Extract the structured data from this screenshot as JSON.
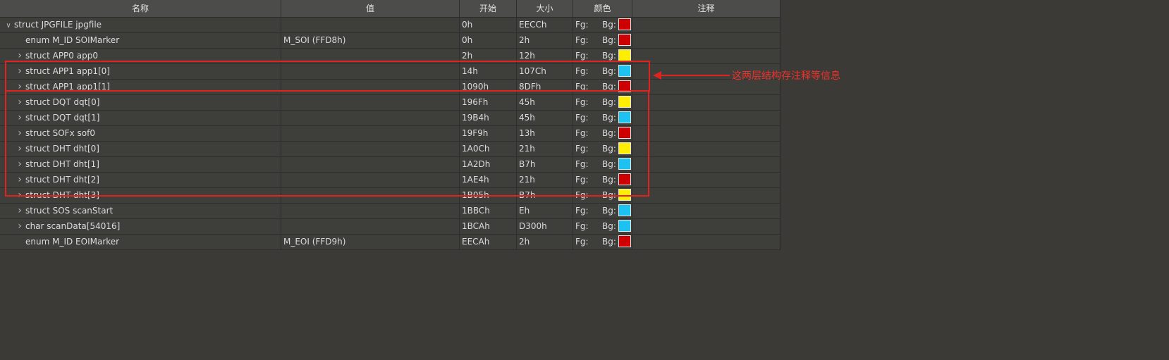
{
  "columns": {
    "name": "名称",
    "value": "值",
    "start": "开始",
    "size": "大小",
    "color": "颜色",
    "note": "注释"
  },
  "rows": [
    {
      "expand": "open",
      "level": 0,
      "name": "struct JPGFILE jpgfile",
      "value": "",
      "start": "0h",
      "size": "EECCh",
      "fg": "Fg:",
      "bg": "Bg:",
      "bgcolor": "#cc0000"
    },
    {
      "expand": "none",
      "level": 1,
      "name": "enum M_ID SOIMarker",
      "value": "M_SOI (FFD8h)",
      "start": "0h",
      "size": "2h",
      "fg": "Fg:",
      "bg": "Bg:",
      "bgcolor": "#cc0000"
    },
    {
      "expand": "closed",
      "level": 1,
      "name": "struct APP0 app0",
      "value": "",
      "start": "2h",
      "size": "12h",
      "fg": "Fg:",
      "bg": "Bg:",
      "bgcolor": "#ffee00"
    },
    {
      "expand": "closed",
      "level": 1,
      "name": "struct APP1 app1[0]",
      "value": "",
      "start": "14h",
      "size": "107Ch",
      "fg": "Fg:",
      "bg": "Bg:",
      "bgcolor": "#1ec2f0"
    },
    {
      "expand": "closed",
      "level": 1,
      "name": "struct APP1 app1[1]",
      "value": "",
      "start": "1090h",
      "size": "8DFh",
      "fg": "Fg:",
      "bg": "Bg:",
      "bgcolor": "#cc0000"
    },
    {
      "expand": "closed",
      "level": 1,
      "name": "struct DQT dqt[0]",
      "value": "",
      "start": "196Fh",
      "size": "45h",
      "fg": "Fg:",
      "bg": "Bg:",
      "bgcolor": "#ffee00"
    },
    {
      "expand": "closed",
      "level": 1,
      "name": "struct DQT dqt[1]",
      "value": "",
      "start": "19B4h",
      "size": "45h",
      "fg": "Fg:",
      "bg": "Bg:",
      "bgcolor": "#1ec2f0"
    },
    {
      "expand": "closed",
      "level": 1,
      "name": "struct SOFx sof0",
      "value": "",
      "start": "19F9h",
      "size": "13h",
      "fg": "Fg:",
      "bg": "Bg:",
      "bgcolor": "#cc0000"
    },
    {
      "expand": "closed",
      "level": 1,
      "name": "struct DHT dht[0]",
      "value": "",
      "start": "1A0Ch",
      "size": "21h",
      "fg": "Fg:",
      "bg": "Bg:",
      "bgcolor": "#ffee00"
    },
    {
      "expand": "closed",
      "level": 1,
      "name": "struct DHT dht[1]",
      "value": "",
      "start": "1A2Dh",
      "size": "B7h",
      "fg": "Fg:",
      "bg": "Bg:",
      "bgcolor": "#1ec2f0"
    },
    {
      "expand": "closed",
      "level": 1,
      "name": "struct DHT dht[2]",
      "value": "",
      "start": "1AE4h",
      "size": "21h",
      "fg": "Fg:",
      "bg": "Bg:",
      "bgcolor": "#cc0000"
    },
    {
      "expand": "closed",
      "level": 1,
      "name": "struct DHT dht[3]",
      "value": "",
      "start": "1B05h",
      "size": "B7h",
      "fg": "Fg:",
      "bg": "Bg:",
      "bgcolor": "#ffee00"
    },
    {
      "expand": "closed",
      "level": 1,
      "name": "struct SOS scanStart",
      "value": "",
      "start": "1BBCh",
      "size": "Eh",
      "fg": "Fg:",
      "bg": "Bg:",
      "bgcolor": "#1ec2f0"
    },
    {
      "expand": "closed",
      "level": 1,
      "name": "char scanData[54016]",
      "value": "",
      "start": "1BCAh",
      "size": "D300h",
      "fg": "Fg:",
      "bg": "Bg:",
      "bgcolor": "#1ec2f0"
    },
    {
      "expand": "none",
      "level": 1,
      "name": "enum M_ID EOIMarker",
      "value": "M_EOI (FFD9h)",
      "start": "EECAh",
      "size": "2h",
      "fg": "Fg:",
      "bg": "Bg:",
      "bgcolor": "#cc0000"
    }
  ],
  "annotation": {
    "text": "这两层结构存注释等信息",
    "color": "#e0231f"
  },
  "theme": {
    "background": "#3b3a36",
    "header": "#4c4c4b",
    "row": "#3e3e3b"
  }
}
